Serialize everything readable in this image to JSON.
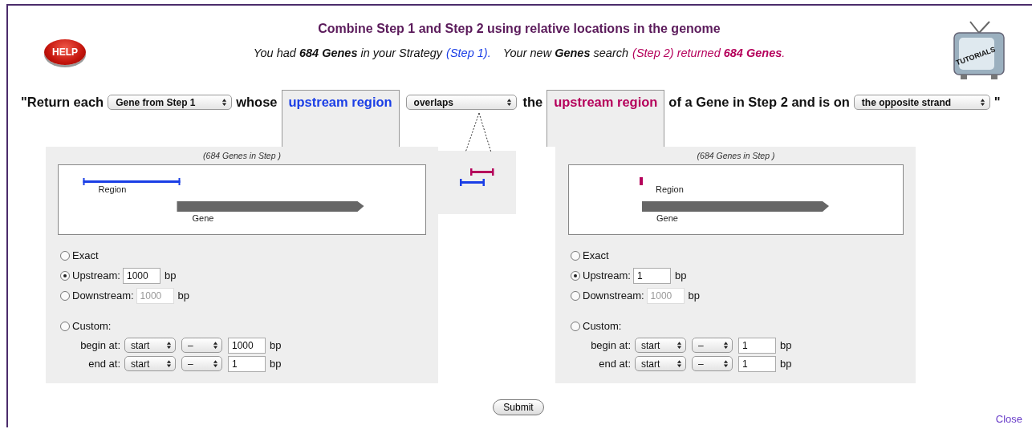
{
  "header": {
    "help_label": "HELP",
    "title": "Combine Step 1 and Step 2 using relative locations in the genome",
    "subtitle": [
      {
        "text": "You had **684 Genes** in your Strategy",
        "color": "#111111"
      },
      {
        "text": "(Step 1).",
        "color": "#1a3ee6"
      },
      {
        "text": "Your new **Genes** search",
        "color": "#111111"
      },
      {
        "text": "(Step 2) returned **684 Genes**.",
        "color": "#b5005b"
      }
    ],
    "tutorials_label": "TUTORIALS"
  },
  "sentence": [
    {
      "kind": "text",
      "text": "\"Return each"
    },
    {
      "kind": "select",
      "value": "Gene from Step 1"
    },
    {
      "kind": "text",
      "text": "whose"
    },
    {
      "kind": "tab",
      "text": "upstream region",
      "color": "#1a3ee6"
    },
    {
      "kind": "select",
      "value": "overlaps"
    },
    {
      "kind": "text",
      "text": "the"
    },
    {
      "kind": "tab",
      "text": "upstream region",
      "color": "#b5005b"
    },
    {
      "kind": "text",
      "text": "of a Gene in Step 2 and is on"
    },
    {
      "kind": "select",
      "value": "the opposite strand"
    },
    {
      "kind": "text",
      "text": "\""
    }
  ],
  "panels": [
    {
      "caption": "(684 Genes in Step )",
      "region_label": "Region",
      "gene_label": "Gene",
      "color": "#1a3ee6",
      "kind": "span",
      "options": [
        {
          "kind": "plain",
          "label": "Exact",
          "selected": false
        },
        {
          "kind": "distance",
          "label": "Upstream:",
          "selected": true,
          "value": "1000",
          "disabled": false,
          "unit": "bp"
        },
        {
          "kind": "distance",
          "label": "Downstream:",
          "selected": false,
          "value": "1000",
          "disabled": true,
          "unit": "bp"
        },
        {
          "kind": "plain",
          "label": "Custom:",
          "selected": false
        }
      ],
      "custom": [
        {
          "label": "begin at:",
          "anchor": "start",
          "sign": "–",
          "value": "1000",
          "unit": "bp"
        },
        {
          "label": "end at:",
          "anchor": "start",
          "sign": "–",
          "value": "1",
          "unit": "bp"
        }
      ]
    },
    {
      "caption": "(684 Genes in Step )",
      "region_label": "Region",
      "gene_label": "Gene",
      "color": "#b5005b",
      "kind": "tick",
      "options": [
        {
          "kind": "plain",
          "label": "Exact",
          "selected": false
        },
        {
          "kind": "distance",
          "label": "Upstream:",
          "selected": true,
          "value": "1",
          "disabled": false,
          "unit": "bp"
        },
        {
          "kind": "distance",
          "label": "Downstream:",
          "selected": false,
          "value": "1000",
          "disabled": true,
          "unit": "bp"
        },
        {
          "kind": "plain",
          "label": "Custom:",
          "selected": false
        }
      ],
      "custom": [
        {
          "label": "begin at:",
          "anchor": "start",
          "sign": "–",
          "value": "1",
          "unit": "bp"
        },
        {
          "label": "end at:",
          "anchor": "start",
          "sign": "–",
          "value": "1",
          "unit": "bp"
        }
      ]
    }
  ],
  "submit": "Submit",
  "close": "Close"
}
